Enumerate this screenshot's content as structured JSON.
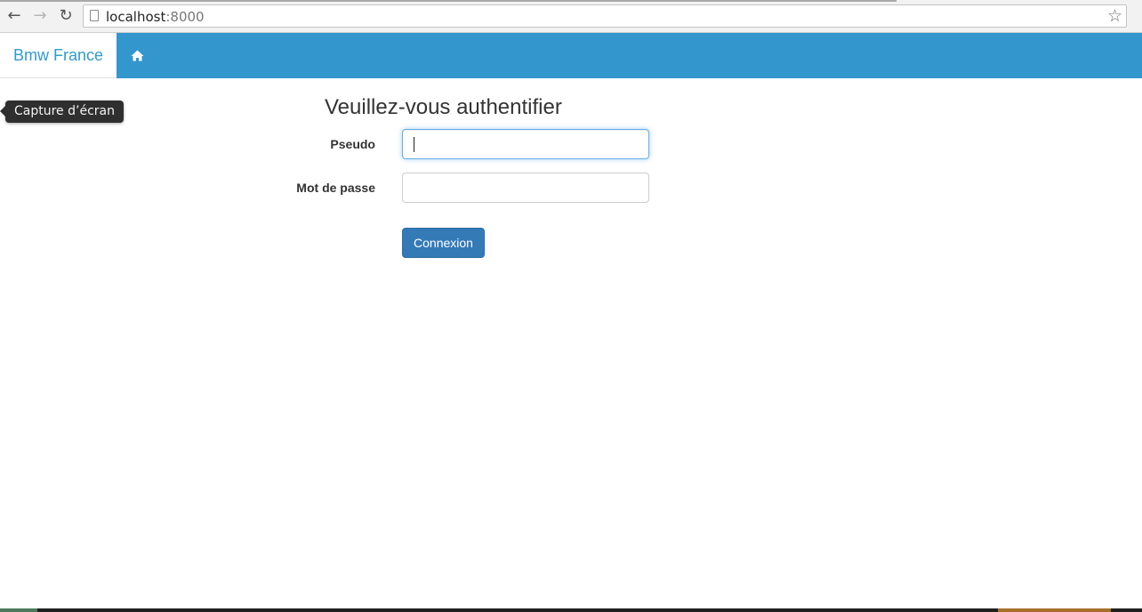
{
  "browser": {
    "url_host": "localhost",
    "url_port": ":8000",
    "back_icon": "arrow-left-icon",
    "forward_icon": "arrow-right-icon",
    "reload_icon": "reload-icon",
    "bookmark_icon": "star-icon"
  },
  "navbar": {
    "brand": "Bmw France",
    "home_icon": "home-icon",
    "color": "#3397ce"
  },
  "tooltip": {
    "text": "Capture d’écran"
  },
  "form": {
    "title": "Veuillez-vous authentifier",
    "pseudo_label": "Pseudo",
    "pseudo_value": "",
    "password_label": "Mot de passe",
    "password_value": "",
    "submit_label": "Connexion",
    "submit_color": "#337ab7"
  }
}
